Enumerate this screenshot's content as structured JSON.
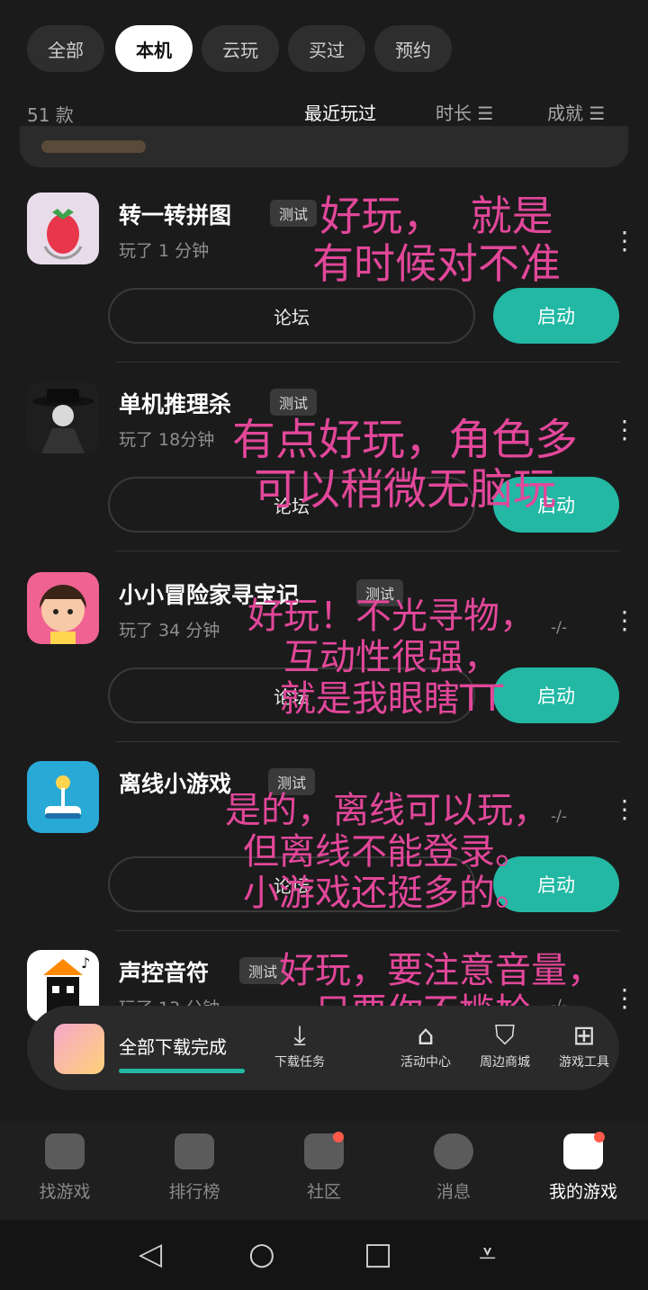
{
  "tabs": [
    "全部",
    "本机",
    "云玩",
    "买过",
    "预约"
  ],
  "active_tab": "本机",
  "count": "51 款",
  "sorts": [
    "最近玩过",
    "时长 ☰",
    "成就 ☰"
  ],
  "games": [
    {
      "title": "转一转拼图",
      "badge": "测试",
      "played": "玩了 1 分钟",
      "forum": "论坛",
      "start": "启动",
      "icon": "strawberry-icon",
      "accent": "#e8364a"
    },
    {
      "title": "单机推理杀",
      "badge": "测试",
      "played": "玩了 18分钟",
      "forum": "论坛",
      "start": "启动",
      "icon": "detective-icon",
      "accent": "#9a9a9a"
    },
    {
      "title": "小小冒险家寻宝记",
      "badge": "测试",
      "played": "玩了 34 分钟",
      "dash": "-/-",
      "forum": "论坛",
      "start": "启动",
      "icon": "girl-icon",
      "accent": "#f06292"
    },
    {
      "title": "离线小游戏",
      "badge": "测试",
      "played": "",
      "dash": "-/-",
      "forum": "论坛",
      "start": "启动",
      "icon": "joystick-icon",
      "accent": "#29a9d6"
    },
    {
      "title": "声控音符",
      "badge": "测试",
      "played": "玩了 13 分钟",
      "dash": "-/-",
      "forum": "",
      "start": "",
      "icon": "music-note-icon",
      "accent": "#ff8a00"
    }
  ],
  "overlays": [
    {
      "text": "好玩，  就是\n有时候对不准"
    },
    {
      "text": "有点好玩，角色多\n可以稍微无脑玩"
    },
    {
      "text": "好玩！不光寻物，\n互动性很强，\n就是我眼瞎TT"
    },
    {
      "text": "是的，离线可以玩，\n但离线不能登录。\n小游戏还挺多的。"
    },
    {
      "text": "好玩，要注意音量，\n只要你不尴尬，\n那尴尬的就是别人"
    }
  ],
  "download": {
    "text": "全部下载完成"
  },
  "tools": [
    "下载任务",
    "活动中心",
    "周边商城",
    "游戏工具"
  ],
  "bottom_nav": [
    "找游戏",
    "排行榜",
    "社区",
    "消息",
    "我的游戏"
  ],
  "brand_color": "#22b8a4",
  "overlay_color": "#e2479a"
}
